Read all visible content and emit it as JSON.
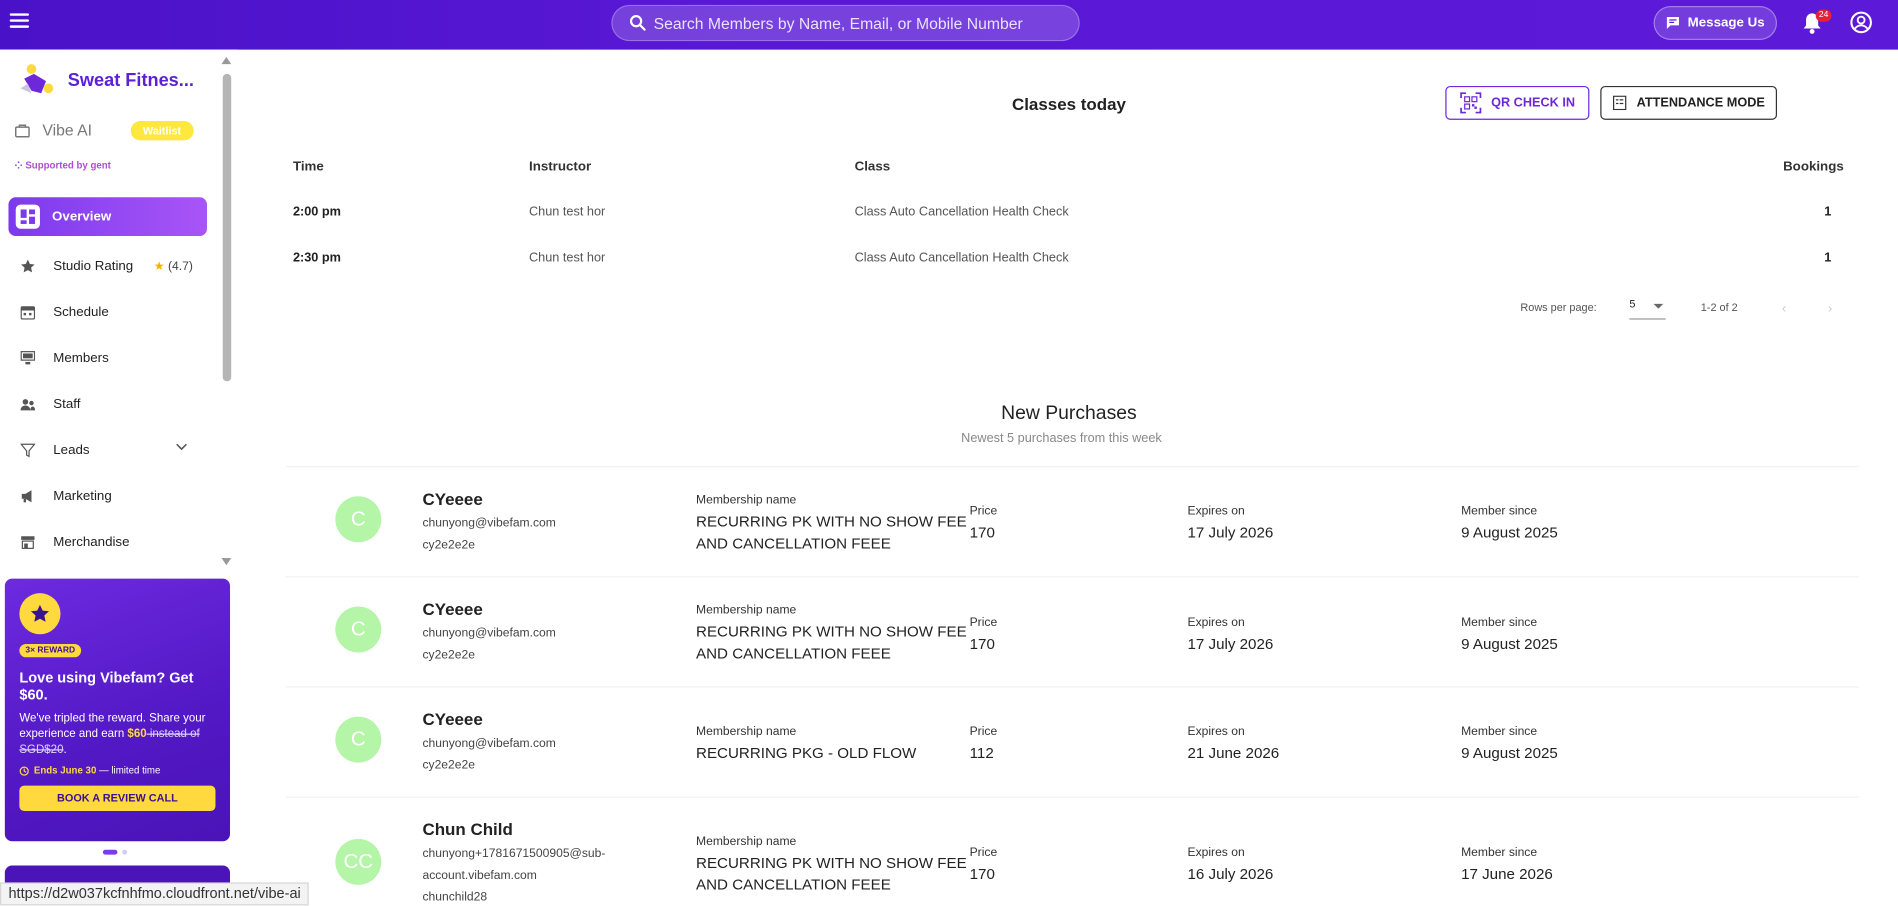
{
  "topbar": {
    "search_placeholder": "Search Members by Name, Email, or Mobile Number",
    "message_label": "Message Us",
    "notification_count": "24"
  },
  "sidebar": {
    "brand": "Sweat Fitnes...",
    "vibe_ai": "Vibe AI",
    "waitlist": "Waitlist",
    "supported": "Supported by   gent",
    "items": [
      {
        "label": "Overview",
        "icon": "dashboard-icon"
      },
      {
        "label": "Studio Rating",
        "icon": "star-icon",
        "rating": "(4.7)"
      },
      {
        "label": "Schedule",
        "icon": "calendar-icon"
      },
      {
        "label": "Members",
        "icon": "members-icon"
      },
      {
        "label": "Staff",
        "icon": "staff-icon"
      },
      {
        "label": "Leads",
        "icon": "filter-icon"
      },
      {
        "label": "Marketing",
        "icon": "megaphone-icon"
      },
      {
        "label": "Merchandise",
        "icon": "store-icon"
      }
    ],
    "promo": {
      "badge": "3× REWARD",
      "title": "Love using Vibefam? Get $60.",
      "desc_part1": "We've tripled the reward. Share your experience and earn ",
      "desc_hl": "$60",
      "desc_strike": " instead of SGD$20",
      "desc_end": ".",
      "ends_bold": "Ends June 30",
      "ends_rest": " — limited time",
      "cta": "BOOK A REVIEW CALL"
    },
    "status_url": "https://d2w037kcfnhfmo.cloudfront.net/vibe-ai"
  },
  "classes": {
    "title": "Classes today",
    "qr_label": "QR CHECK IN",
    "attendance_label": "ATTENDANCE MODE",
    "headers": {
      "time": "Time",
      "instructor": "Instructor",
      "class": "Class",
      "bookings": "Bookings"
    },
    "rows": [
      {
        "time": "2:00 pm",
        "instructor": "Chun test hor",
        "class": "Class Auto Cancellation Health Check",
        "bookings": "1"
      },
      {
        "time": "2:30 pm",
        "instructor": "Chun test hor",
        "class": "Class Auto Cancellation Health Check",
        "bookings": "1"
      }
    ],
    "rows_per_page_label": "Rows per page:",
    "rows_per_page": "5",
    "range": "1-2 of 2"
  },
  "purchases": {
    "title": "New Purchases",
    "subtitle": "Newest 5 purchases from this week",
    "labels": {
      "membership": "Membership name",
      "price": "Price",
      "expires": "Expires on",
      "since": "Member since"
    },
    "items": [
      {
        "initials": "C",
        "name": "CYeeee",
        "email": "chunyong@vibefam.com",
        "username": "cy2e2e2e",
        "membership_l1": "RECURRING PK WITH NO SHOW FEE",
        "membership_l2": "AND CANCELLATION FEEE",
        "price": "170",
        "expires": "17 July 2026",
        "since": "9 August 2025"
      },
      {
        "initials": "C",
        "name": "CYeeee",
        "email": "chunyong@vibefam.com",
        "username": "cy2e2e2e",
        "membership_l1": "RECURRING PK WITH NO SHOW FEE",
        "membership_l2": "AND CANCELLATION FEEE",
        "price": "170",
        "expires": "17 July 2026",
        "since": "9 August 2025"
      },
      {
        "initials": "C",
        "name": "CYeeee",
        "email": "chunyong@vibefam.com",
        "username": "cy2e2e2e",
        "membership_l1": "RECURRING PKG - OLD FLOW",
        "membership_l2": "",
        "price": "112",
        "expires": "21 June 2026",
        "since": "9 August 2025"
      },
      {
        "initials": "CC",
        "name": "Chun Child",
        "email": "chunyong+1781671500905@sub-",
        "email2": "account.vibefam.com",
        "username": "chunchild28",
        "membership_l1": "RECURRING PK WITH NO SHOW FEE",
        "membership_l2": "AND CANCELLATION FEEE",
        "price": "170",
        "expires": "16 July 2026",
        "since": "17 June 2026"
      }
    ]
  },
  "colors": {
    "brand": "#5b21d6",
    "accent": "#7c3aed",
    "promo_yellow": "#ffd93d",
    "avatar_green": "#b5f5a8"
  }
}
